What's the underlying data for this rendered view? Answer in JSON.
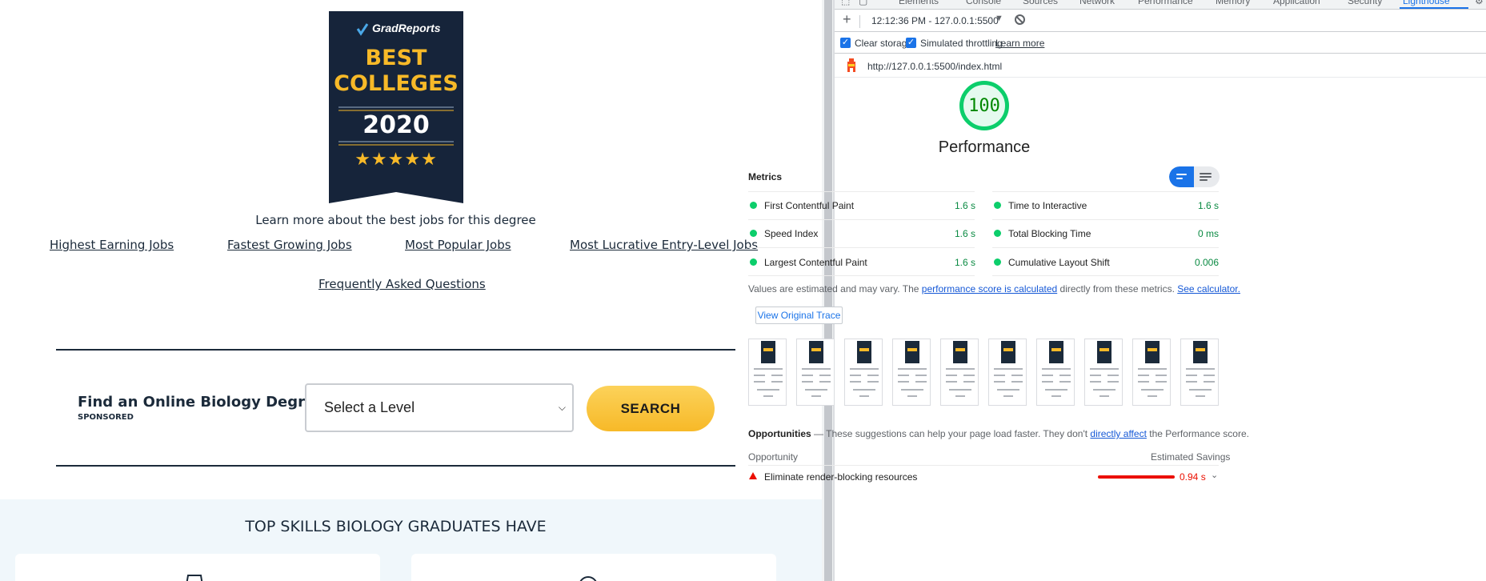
{
  "page": {
    "badge": {
      "brand": "GradReports",
      "line1": "BEST",
      "line2": "COLLEGES",
      "year": "2020",
      "stars": "★★★★★"
    },
    "learn_text": "Learn more about the best jobs for this degree",
    "job_links": [
      "Highest Earning Jobs",
      "Fastest Growing Jobs",
      "Most Popular Jobs",
      "Most Lucrative Entry-Level Jobs"
    ],
    "faq_link": "Frequently Asked Questions",
    "find_label": "Find an Online Biology Degree:",
    "sponsored": "SPONSORED",
    "select_value": "Select a Level",
    "search_label": "SEARCH",
    "skills_title": "TOP SKILLS BIOLOGY GRADUATES HAVE"
  },
  "devtools": {
    "tabs": [
      "Elements",
      "Console",
      "Sources",
      "Network",
      "Performance",
      "Memory",
      "Application",
      "Security",
      "Lighthouse"
    ],
    "active_tab": "Lighthouse",
    "report_label": "12:12:36 PM - 127.0.0.1:5500",
    "clear_storage": "Clear storage",
    "simulated_throttling": "Simulated throttling",
    "learn_more": "Learn more",
    "url": "http://127.0.0.1:5500/index.html",
    "score": "100",
    "category": "Performance",
    "metrics_heading": "Metrics",
    "metrics_left": [
      {
        "name": "First Contentful Paint",
        "value": "1.6 s"
      },
      {
        "name": "Speed Index",
        "value": "1.6 s"
      },
      {
        "name": "Largest Contentful Paint",
        "value": "1.6 s"
      }
    ],
    "metrics_right": [
      {
        "name": "Time to Interactive",
        "value": "1.6 s"
      },
      {
        "name": "Total Blocking Time",
        "value": "0 ms"
      },
      {
        "name": "Cumulative Layout Shift",
        "value": "0.006"
      }
    ],
    "note_prefix": "Values are estimated and may vary. The ",
    "note_link1": "performance score is calculated",
    "note_mid": " directly from these metrics. ",
    "note_link2": "See calculator.",
    "trace_button": "View Original Trace",
    "opportunities_title": "Opportunities",
    "opportunities_prefix": " — These suggestions can help your page load faster. They don't ",
    "opportunities_link": "directly affect",
    "opportunities_suffix": " the Performance score.",
    "col_opportunity": "Opportunity",
    "col_savings": "Estimated Savings",
    "opportunity_item": {
      "name": "Eliminate render-blocking resources",
      "value": "0.94 s"
    },
    "colors": {
      "pass": "#0cce6b",
      "fail": "#eb0f00",
      "accent": "#1a73e8"
    }
  }
}
